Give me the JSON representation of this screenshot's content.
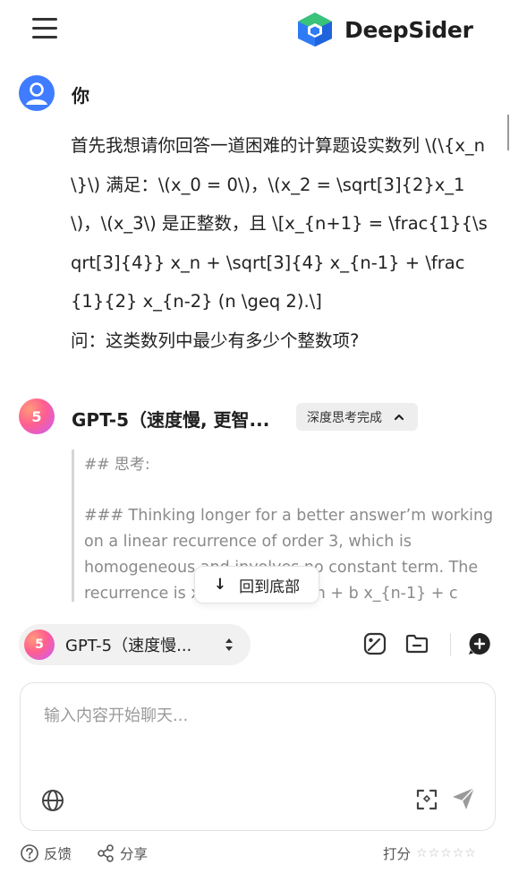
{
  "header": {
    "brand_name": "DeepSider",
    "menu_icon": "hamburger-menu-icon",
    "logo_icon": "deepsider-hexagon-logo",
    "brand_colors": [
      "#39c27a",
      "#2f7bf6",
      "#1fb6c9"
    ]
  },
  "user_message": {
    "sender": "你",
    "text": "首先我想请你回答一道困难的计算题设实数列 \\(\\{x_n\\}\\) 满足：\\(x_0 = 0\\)，\\(x_2 = \\sqrt[3]{2}x_1\\)，\\(x_3\\) 是正整数，且 \\[x_{n+1} = \\frac{1}{\\sqrt[3]{4}} x_n + \\sqrt[3]{4} x_{n-1} + \\frac{1}{2} x_{n-2} (n \\geq 2).\\]\n问：这类数列中最少有多少个整数项?"
  },
  "ai_message": {
    "avatar_label": "5",
    "model_name": "GPT-5（速度慢, 更智...",
    "thinking_badge": "深度思考完成",
    "thinking_heading": "## 思考:",
    "thinking_text": "### Thinking longer for a better answer’m working on a linear recurrence of order 3, which is homogeneous and involves no constant term. The recurrence is x_{n+1} = a x_n + b x_{n-1} + c"
  },
  "scroll_to_bottom": {
    "arrow": "↓",
    "label": "回到底部"
  },
  "composer": {
    "model_avatar_label": "5",
    "model_label": "GPT-5（速度慢...",
    "placeholder": "输入内容开始聊天...",
    "accent_color": "#3f7cff"
  },
  "footer": {
    "feedback_label": "反馈",
    "share_label": "分享",
    "rate_label": "打分",
    "rating": 0,
    "rating_max": 5
  }
}
